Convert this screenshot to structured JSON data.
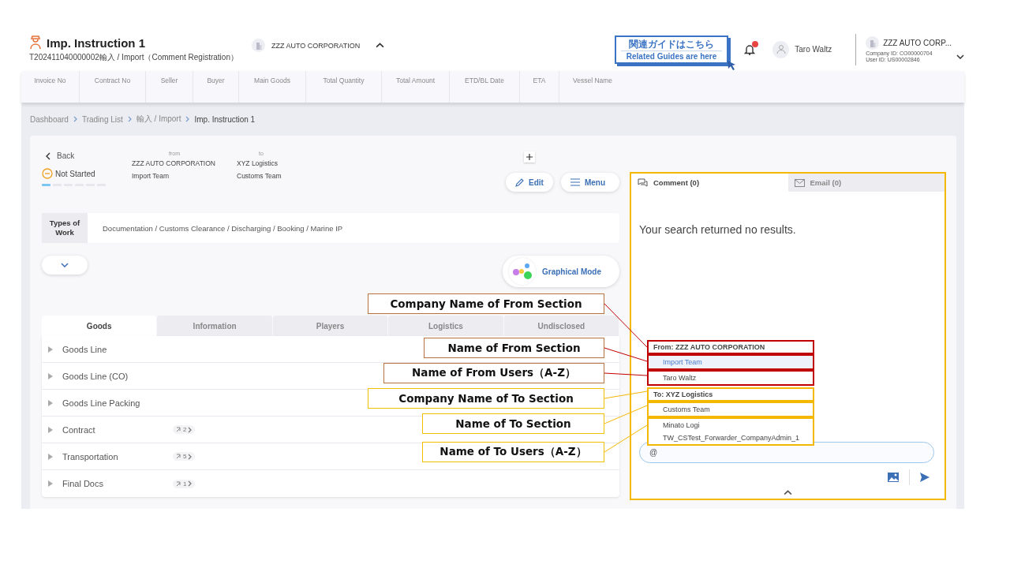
{
  "header": {
    "title": "Imp. Instruction 1",
    "subtitle": "T202411040000002輸入 / Import（Comment Registration）",
    "company_selector": "ZZZ AUTO CORPORATION",
    "guide_button": {
      "line_1": "関連ガイドはこちら",
      "line_2": "Related Guides are here"
    },
    "notification_unread": true,
    "user_name": "Taro Waltz",
    "account": {
      "company": "ZZZ AUTO CORP...",
      "company_id": "Company ID: CO00000704",
      "user_id": "User ID: US00002846"
    }
  },
  "summary_columns": [
    "Invoice No",
    "Contract No",
    "Seller",
    "Buyer",
    "Main Goods",
    "Total Quantity",
    "Total Amount",
    "ETD/BL Date",
    "ETA",
    "Vessel Name"
  ],
  "breadcrumb": [
    "Dashboard",
    "Trading List",
    "輸入 / Import",
    "Imp. Instruction 1"
  ],
  "instruction": {
    "back": "Back",
    "status": "Not Started",
    "level": 0.17,
    "from_label": "from",
    "from_company": "ZZZ AUTO CORPORATION",
    "from_section": "Import Team",
    "to_label": "to",
    "to_company": "XYZ Logistics",
    "to_section": "Customs Team",
    "edit": "Edit",
    "menu": "Menu",
    "types_label": "Types of Work",
    "types_value": "Documentation / Customs Clearance / Discharging / Booking / Marine IP",
    "graphical_mode": "Graphical Mode"
  },
  "tabs": [
    {
      "label": "Goods",
      "selected": true
    },
    {
      "label": "Information",
      "selected": false
    },
    {
      "label": "Players",
      "selected": false
    },
    {
      "label": "Logistics",
      "selected": false
    },
    {
      "label": "Undisclosed",
      "selected": false
    }
  ],
  "rows": [
    {
      "label": "Goods Line"
    },
    {
      "label": "Goods Line (CO)"
    },
    {
      "label": "Goods Line Packing"
    },
    {
      "label": "Contract",
      "count": "2"
    },
    {
      "label": "Transportation",
      "count": "5"
    },
    {
      "label": "Final Docs",
      "count": "1"
    }
  ],
  "comment_panel": {
    "tabs": [
      {
        "label": "Comment (0)",
        "kind": "comment",
        "selected": true
      },
      {
        "label": "Email (0)",
        "kind": "email",
        "selected": false
      }
    ],
    "message": "Your search returned no results.",
    "input_value": "@"
  },
  "mention_list": [
    {
      "header": "From: ZZZ AUTO CORPORATION",
      "color": "#c00000",
      "section": {
        "label": "Import Team",
        "selected": true
      },
      "users": [
        {
          "label": "Taro Waltz",
          "selected": false
        }
      ]
    },
    {
      "header": "To: XYZ Logistics",
      "color": "#f5b800",
      "section": {
        "label": "Customs Team",
        "selected": false
      },
      "users": [
        {
          "label": "Minato Logi",
          "selected": false
        },
        {
          "label": "TW_CSTest_Forwarder_CompanyAdmin_1",
          "selected": false
        }
      ]
    }
  ],
  "callouts": [
    {
      "text": "Company Name of From Section",
      "color": "#b8723f"
    },
    {
      "text": "Name of From Section",
      "color": "#b8723f"
    },
    {
      "text": "Name of From Users（A-Z）",
      "color": "#b8723f"
    },
    {
      "text": "Company Name of To Section",
      "color": "#f0c000"
    },
    {
      "text": "Name of To Section",
      "color": "#f0c000"
    },
    {
      "text": "Name of To Users（A-Z）",
      "color": "#f0c000"
    }
  ]
}
